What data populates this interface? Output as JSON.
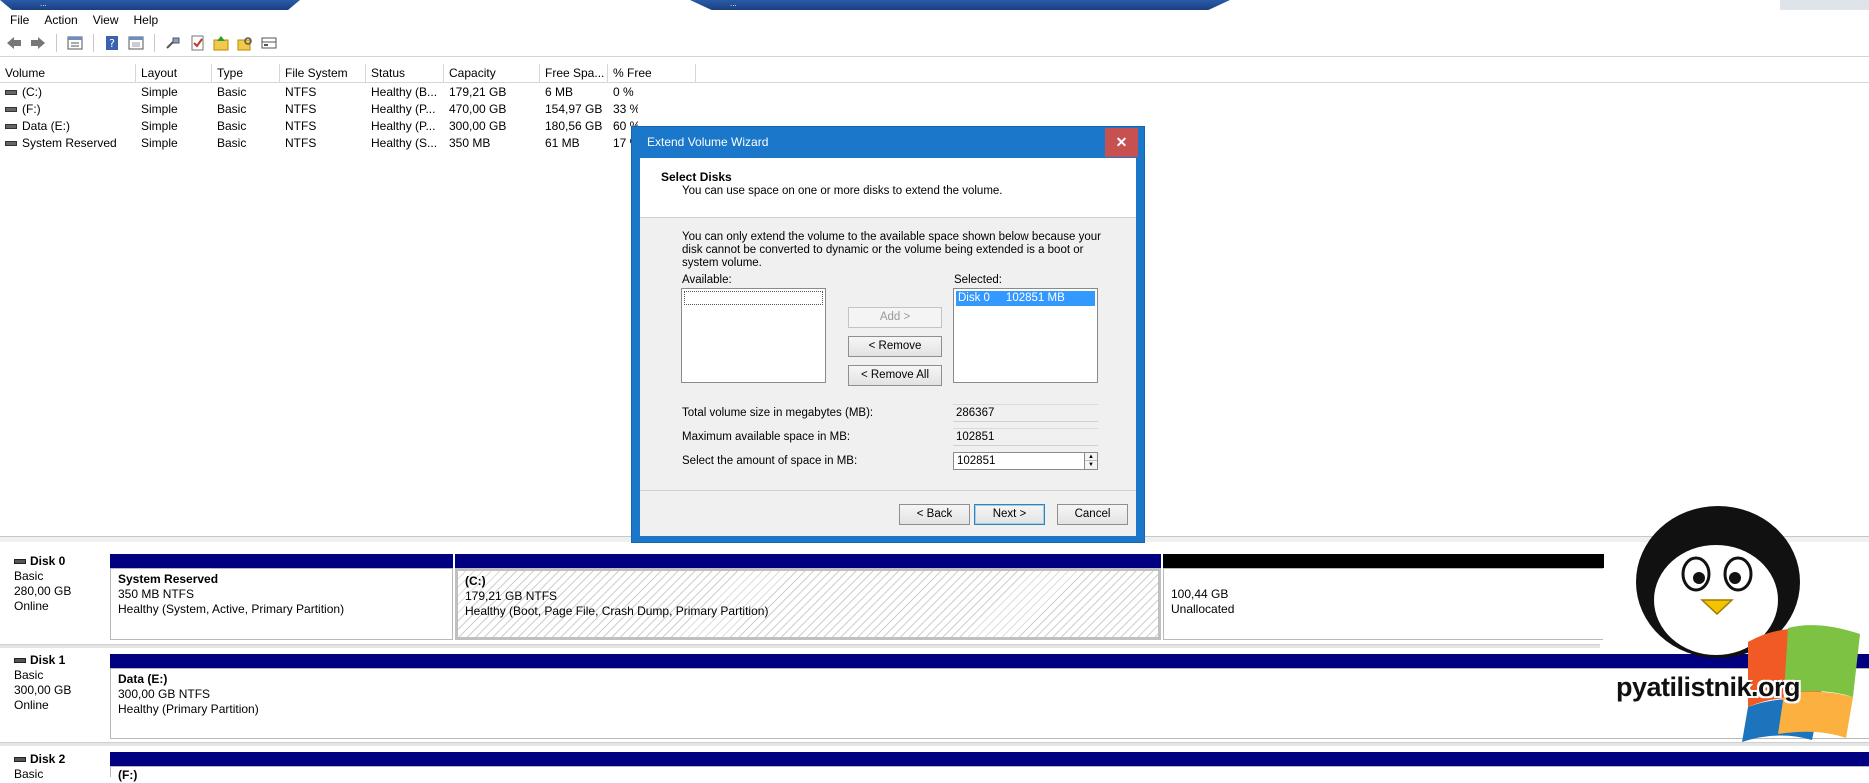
{
  "remote_tabs": [
    "...",
    "..."
  ],
  "menu": [
    "File",
    "Action",
    "View",
    "Help"
  ],
  "toolbar_icons": [
    "back-arrow-icon",
    "forward-arrow-icon",
    "list-view-icon",
    "help-icon",
    "properties-icon",
    "connect-icon",
    "check-icon",
    "folder-up-icon",
    "search-folder-icon",
    "disk-view-icon"
  ],
  "volume_list": {
    "columns": [
      "Volume",
      "Layout",
      "Type",
      "File System",
      "Status",
      "Capacity",
      "Free Spa...",
      "% Free"
    ],
    "rows": [
      [
        "(C:)",
        "Simple",
        "Basic",
        "NTFS",
        "Healthy (B...",
        "179,21 GB",
        "6 MB",
        "0 %"
      ],
      [
        "(F:)",
        "Simple",
        "Basic",
        "NTFS",
        "Healthy (P...",
        "470,00 GB",
        "154,97 GB",
        "33 %"
      ],
      [
        "Data (E:)",
        "Simple",
        "Basic",
        "NTFS",
        "Healthy (P...",
        "300,00 GB",
        "180,56 GB",
        "60 %"
      ],
      [
        "System Reserved",
        "Simple",
        "Basic",
        "NTFS",
        "Healthy (S...",
        "350 MB",
        "61 MB",
        "17 %"
      ]
    ]
  },
  "disks": [
    {
      "name": "Disk 0",
      "type": "Basic",
      "size": "280,00 GB",
      "state": "Online",
      "partitions": [
        {
          "title": "System Reserved",
          "size": "350 MB NTFS",
          "status": "Healthy (System, Active, Primary Partition)"
        },
        {
          "title": "(C:)",
          "size": "179,21 GB NTFS",
          "status": "Healthy (Boot, Page File, Crash Dump, Primary Partition)"
        },
        {
          "title": "",
          "size": "100,44 GB",
          "status": "Unallocated"
        }
      ]
    },
    {
      "name": "Disk 1",
      "type": "Basic",
      "size": "300,00 GB",
      "state": "Online",
      "partitions": [
        {
          "title": "Data  (E:)",
          "size": "300,00 GB NTFS",
          "status": "Healthy (Primary Partition)"
        }
      ]
    },
    {
      "name": "Disk 2",
      "type": "Basic",
      "size": "",
      "state": "",
      "partitions": [
        {
          "title": "(F:)",
          "size": "",
          "status": ""
        }
      ]
    }
  ],
  "dialog": {
    "title": "Extend Volume Wizard",
    "close": "✕",
    "heading": "Select Disks",
    "subheading": "You can use space on one or more disks to extend the volume.",
    "info": "You can only extend the volume to the available space shown below because your disk cannot be converted to dynamic or the volume being extended is a boot or system volume.",
    "available_label": "Available:",
    "selected_label": "Selected:",
    "selected_items": [
      "Disk 0     102851 MB"
    ],
    "add": "Add >",
    "remove": "< Remove",
    "remove_all": "< Remove All",
    "total_label": "Total volume size in megabytes (MB):",
    "total_value": "286367",
    "max_label": "Maximum available space in MB:",
    "max_value": "102851",
    "amount_label": "Select the amount of space in MB:",
    "amount_value": "102851",
    "back": "< Back",
    "next": "Next >",
    "cancel": "Cancel"
  },
  "watermark": "pyatilistnik.org"
}
